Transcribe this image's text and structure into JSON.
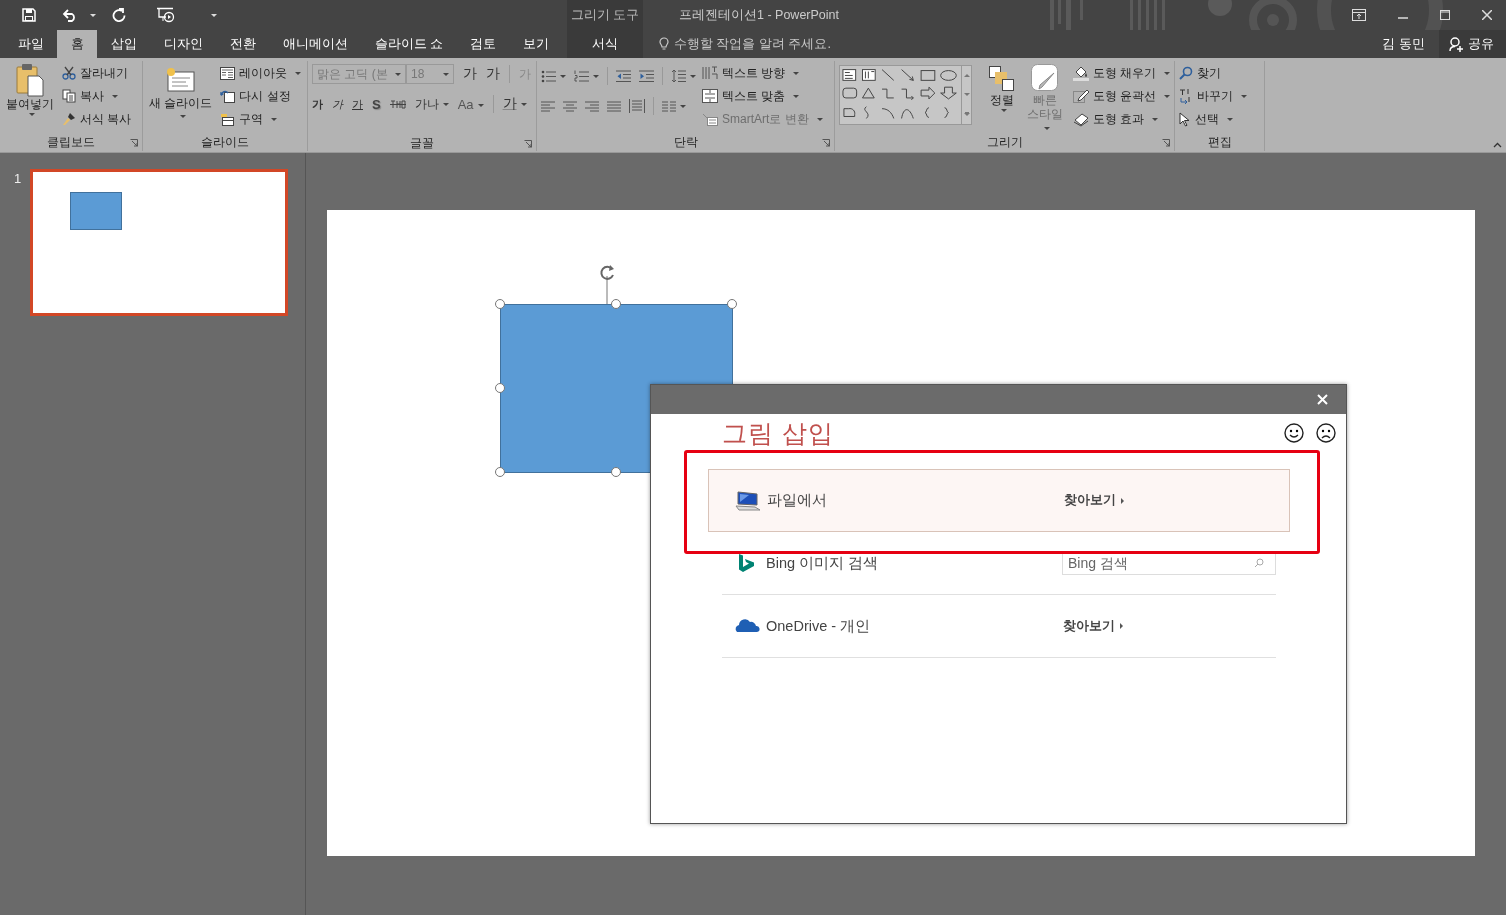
{
  "title_bar": {
    "context_label": "그리기 도구",
    "title": "프레젠테이션1 - PowerPoint"
  },
  "tabs": [
    {
      "label": "파일",
      "kind": "standard",
      "selected": false
    },
    {
      "label": "홈",
      "kind": "standard",
      "selected": true
    },
    {
      "label": "삽입",
      "kind": "standard",
      "selected": false
    },
    {
      "label": "디자인",
      "kind": "standard",
      "selected": false
    },
    {
      "label": "전환",
      "kind": "standard",
      "selected": false
    },
    {
      "label": "애니메이션",
      "kind": "standard",
      "selected": false
    },
    {
      "label": "슬라이드 쇼",
      "kind": "standard",
      "selected": false
    },
    {
      "label": "검토",
      "kind": "standard",
      "selected": false
    },
    {
      "label": "보기",
      "kind": "standard",
      "selected": false
    },
    {
      "label": "서식",
      "kind": "contextual",
      "selected": false
    }
  ],
  "tell_me": {
    "placeholder": "수행할 작업을 알려 주세요."
  },
  "account": {
    "user": "김 동민",
    "share": "공유"
  },
  "ribbon": {
    "clipboard": {
      "name": "클립보드",
      "paste": "붙여넣기",
      "cut": "잘라내기",
      "copy": "복사",
      "format_painter": "서식 복사"
    },
    "slides": {
      "name": "슬라이드",
      "new_slide": "새 슬라이드",
      "layout": "레이아웃",
      "reset": "다시 설정",
      "section": "구역"
    },
    "font": {
      "name": "글꼴",
      "font_name": {
        "value": "맑은 고딕 (본",
        "disabled": true
      },
      "font_size": {
        "value": "18",
        "disabled": true
      },
      "grow": "가",
      "shrink": "가",
      "clear": "가",
      "bold": "가",
      "italic": "가",
      "underline": "가",
      "shadow": "S",
      "spacing": "가나",
      "change_case": "Aa",
      "font_color": "가"
    },
    "paragraph": {
      "name": "단락",
      "text_direction": "텍스트 방향",
      "align_text": "텍스트 맞춤",
      "smartart": {
        "label": "SmartArt로 변환",
        "disabled": true
      }
    },
    "drawing": {
      "name": "그리기",
      "arrange": "정렬",
      "quick_styles": {
        "label": "빠른 스타일",
        "disabled": true
      },
      "fill": "도형 채우기",
      "outline": "도형 윤곽선",
      "effects": "도형 효과"
    },
    "editing": {
      "name": "편집",
      "find": "찾기",
      "replace": "바꾸기",
      "select": "선택"
    }
  },
  "slides_panel": [
    {
      "number": "1",
      "selected": true
    }
  ],
  "slide": {
    "shape": {
      "selected": true
    }
  },
  "insert_pictures_dialog": {
    "title": "그림 삽입",
    "sources": [
      {
        "kind": "browse",
        "label": "파일에서",
        "action": "찾아보기",
        "selected": true
      },
      {
        "kind": "search",
        "label": "Bing 이미지 검색",
        "placeholder": "Bing 검색",
        "selected": false
      },
      {
        "kind": "browse",
        "label": "OneDrive - 개인",
        "action": "찾아보기",
        "selected": false
      }
    ]
  }
}
